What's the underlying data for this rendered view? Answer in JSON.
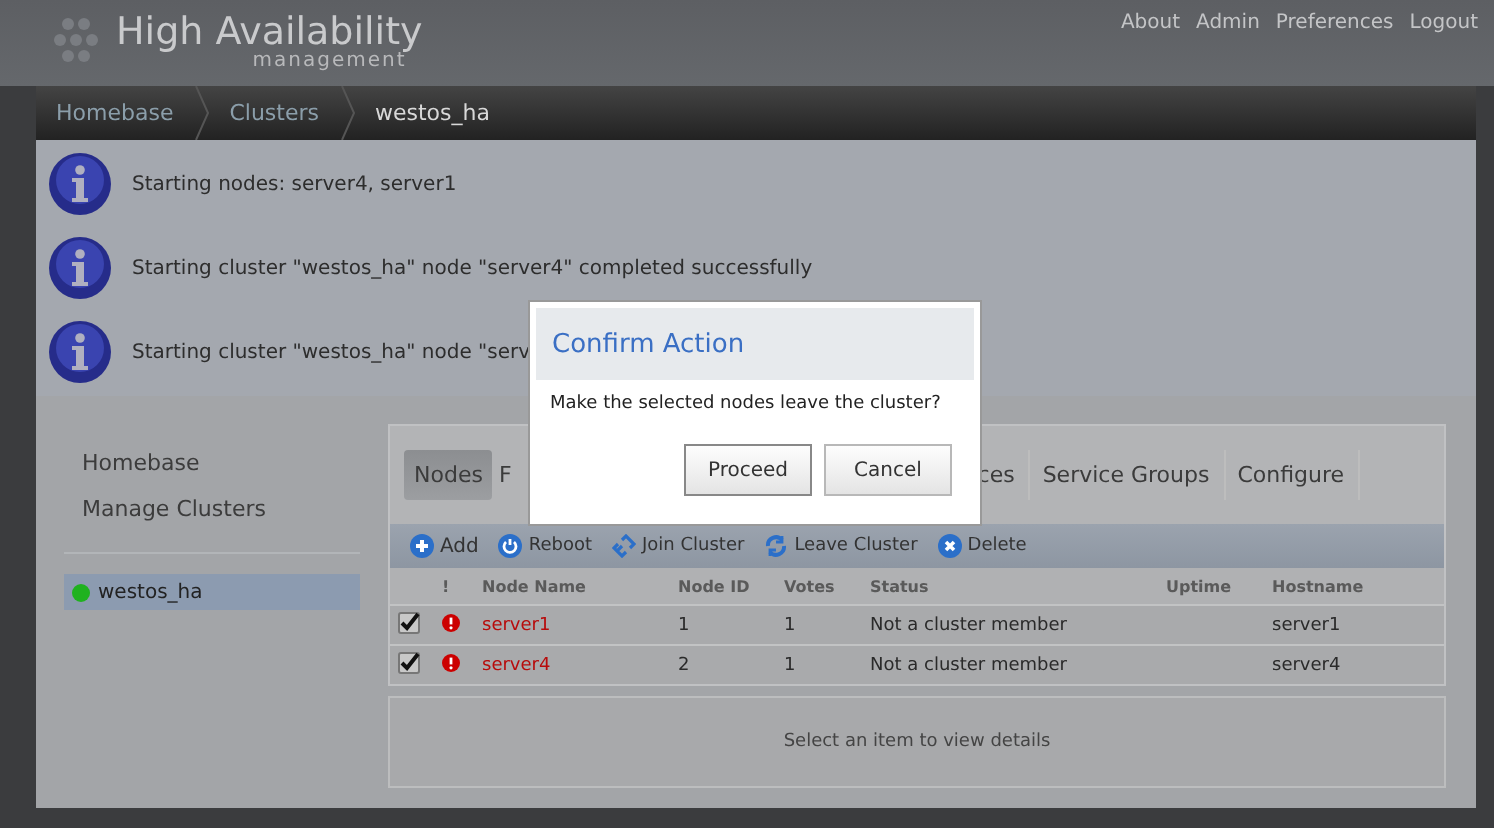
{
  "header": {
    "logo_title": "High Availability",
    "logo_subtitle": "management",
    "links": [
      "About",
      "Admin",
      "Preferences",
      "Logout"
    ]
  },
  "breadcrumb": [
    "Homebase",
    "Clusters",
    "westos_ha"
  ],
  "messages": [
    "Starting nodes: server4, server1",
    "Starting cluster \"westos_ha\" node \"server4\" completed successfully",
    "Starting cluster \"westos_ha\" node \"serv"
  ],
  "sidebar": {
    "items": [
      "Homebase",
      "Manage Clusters"
    ],
    "clusters": [
      {
        "name": "westos_ha",
        "color": "#1fb21f",
        "selected": true
      }
    ]
  },
  "tabs": [
    {
      "label": "Nodes",
      "selected": true
    },
    {
      "label": "F",
      "selected": false
    },
    {
      "label": "ces",
      "selected": false
    },
    {
      "label": "Service Groups",
      "selected": false
    },
    {
      "label": "Configure",
      "selected": false
    }
  ],
  "toolbar": [
    {
      "label": "Add",
      "kind": "add"
    },
    {
      "label": "Reboot",
      "kind": "reboot"
    },
    {
      "label": "Join Cluster",
      "kind": "join"
    },
    {
      "label": "Leave Cluster",
      "kind": "leave"
    },
    {
      "label": "Delete",
      "kind": "delete"
    }
  ],
  "table": {
    "columns": [
      "!",
      "Node Name",
      "Node ID",
      "Votes",
      "Status",
      "Uptime",
      "Hostname"
    ],
    "rows": [
      {
        "checked": true,
        "error": true,
        "name": "server1",
        "node_id": "1",
        "votes": "1",
        "status": "Not a cluster member",
        "hostname": "server1"
      },
      {
        "checked": true,
        "error": true,
        "name": "server4",
        "node_id": "2",
        "votes": "1",
        "status": "Not a cluster member",
        "hostname": "server4"
      }
    ]
  },
  "details": "Select an item to view details",
  "dialog": {
    "title": "Confirm Action",
    "message": "Make the selected nodes leave the cluster?",
    "buttons": [
      "Proceed",
      "Cancel"
    ]
  }
}
